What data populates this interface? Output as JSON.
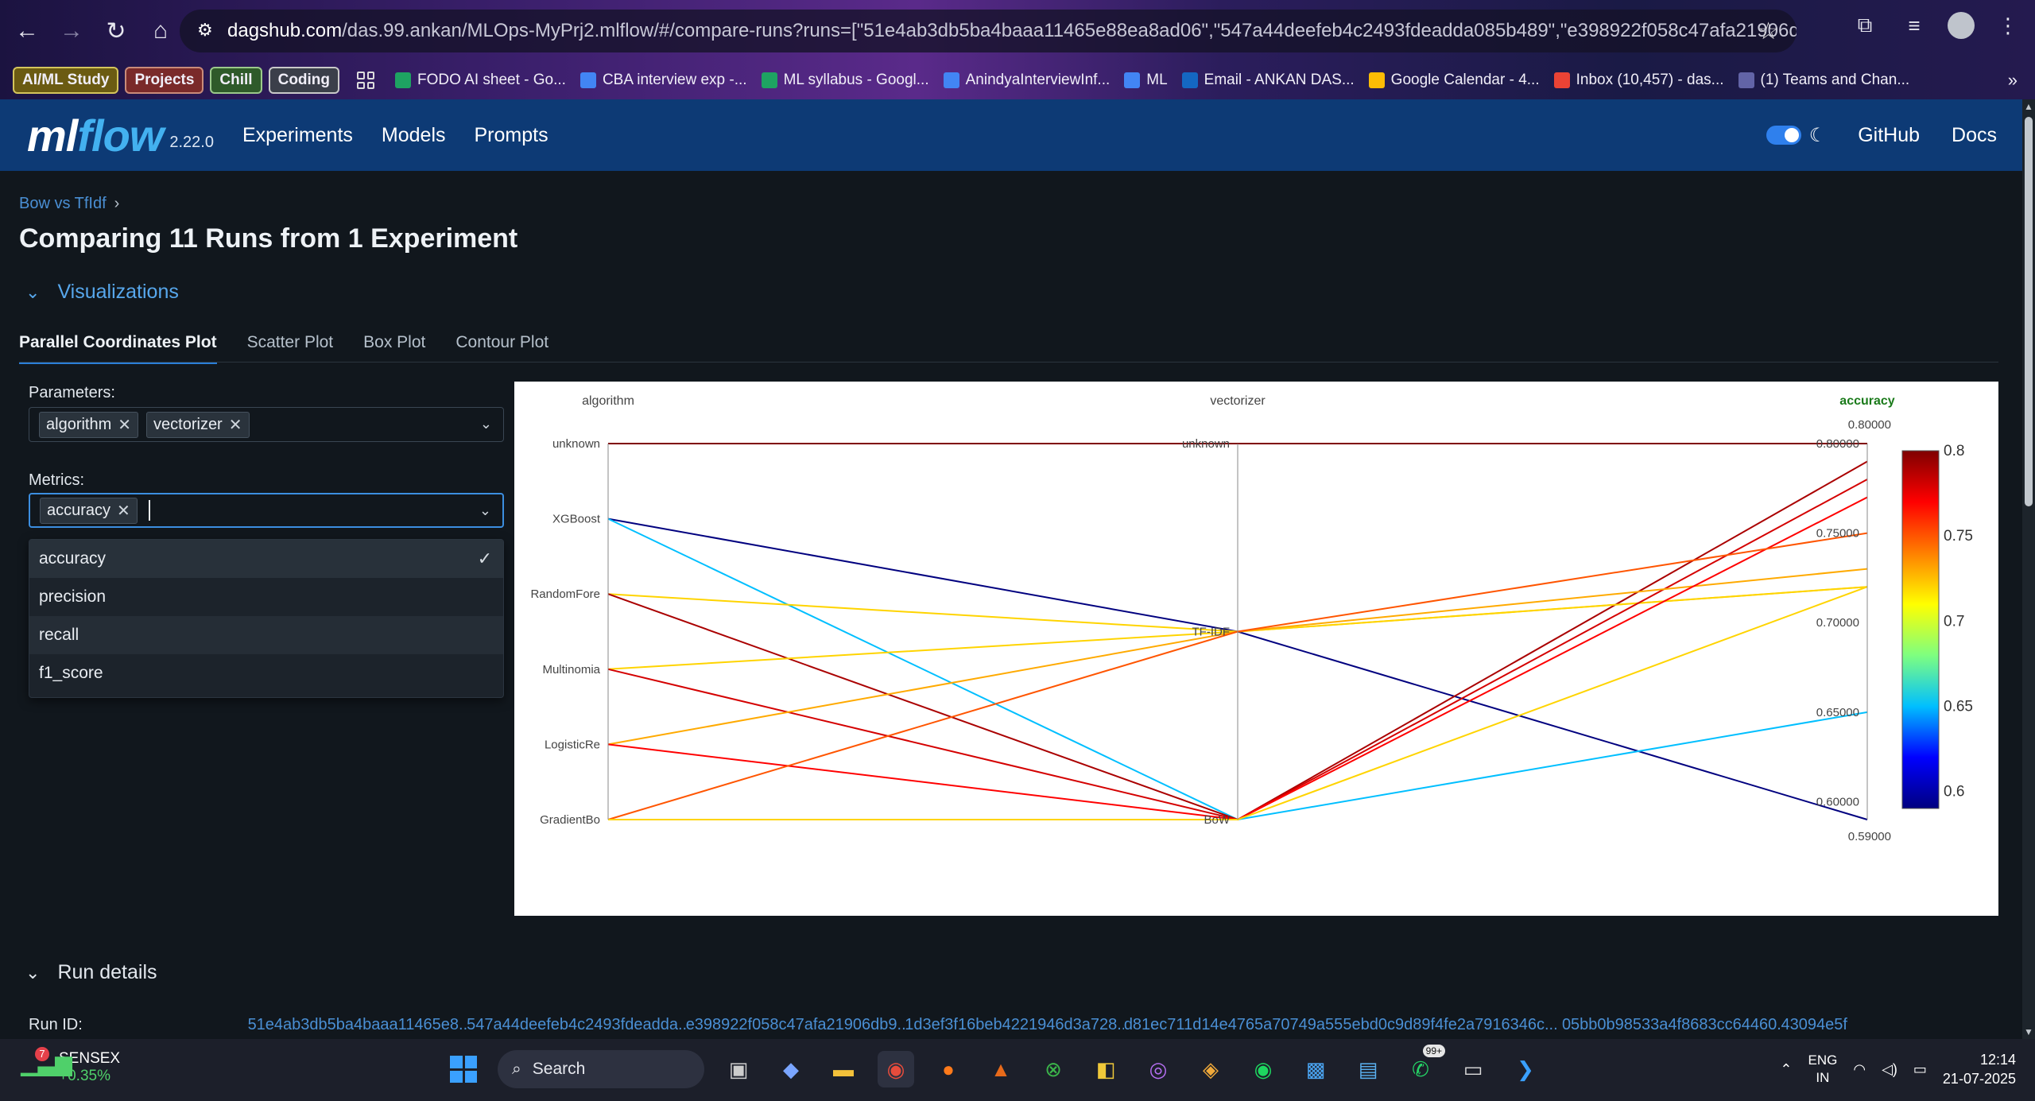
{
  "browser": {
    "url_host": "dagshub.com",
    "url_rest": "/das.99.ankan/MLOps-MyPrj2.mlflow/#/compare-runs?runs=[\"51e4ab3db5ba4baaa11465e88ea8ad06\",\"547a44deefeb4c2493fdeadda085b489\",\"e398922f058c47afa21906db92a2320e\",\"1d3ef3f16...",
    "bookmark_groups": [
      "AI/ML Study",
      "Projects",
      "Chill",
      "Coding"
    ],
    "bookmarks": [
      {
        "label": "FODO AI sheet - Go...",
        "color": "#1ea362"
      },
      {
        "label": "CBA interview exp -...",
        "color": "#4285f4"
      },
      {
        "label": "ML syllabus - Googl...",
        "color": "#1ea362"
      },
      {
        "label": "AnindyaInterviewInf...",
        "color": "#4285f4"
      },
      {
        "label": "ML",
        "color": "#4285f4"
      },
      {
        "label": "Email - ANKAN DAS...",
        "color": "#1467c2"
      },
      {
        "label": "Google Calendar - 4...",
        "color": "#fbbc05"
      },
      {
        "label": "Inbox (10,457) - das...",
        "color": "#ea4335"
      },
      {
        "label": "(1) Teams and Chan...",
        "color": "#6264a7"
      }
    ]
  },
  "mlflow": {
    "logo_ml": "ml",
    "logo_flow": "flow",
    "version": "2.22.0",
    "nav": [
      "Experiments",
      "Models",
      "Prompts"
    ],
    "github": "GitHub",
    "docs": "Docs"
  },
  "page": {
    "breadcrumb": "Bow vs TfIdf",
    "breadcrumb_sep": "›",
    "title": "Comparing 11 Runs from 1 Experiment",
    "section": "Visualizations",
    "tabs": [
      "Parallel Coordinates Plot",
      "Scatter Plot",
      "Box Plot",
      "Contour Plot"
    ],
    "params_label": "Parameters:",
    "params_chips": [
      "algorithm",
      "vectorizer"
    ],
    "metrics_label": "Metrics:",
    "metrics_chips": [
      "accuracy"
    ],
    "dropdown_options": [
      "accuracy",
      "precision",
      "recall",
      "f1_score"
    ],
    "run_details": "Run details",
    "run_id_label": "Run ID:",
    "run_ids": [
      "51e4ab3db5ba4baaa11465e8...",
      "547a44deefeb4c2493fdeadda...",
      "e398922f058c47afa21906db9...",
      "1d3ef3f16beb4221946d3a728...",
      "d81ec711d14e4765a70749a55...",
      "5ebd0c9d89f4fe2a7916346c...",
      "05bb0b98533a4f8683cc64460...",
      "43094e5f"
    ]
  },
  "chart_data": {
    "type": "parallel-coordinates",
    "axes": [
      {
        "name": "algorithm",
        "categories": [
          "unknown",
          "XGBoost",
          "RandomFore",
          "Multinomia",
          "LogisticRe",
          "GradientBo"
        ]
      },
      {
        "name": "vectorizer",
        "categories": [
          "unknown",
          "TF-IDF",
          "BoW"
        ]
      },
      {
        "name": "accuracy",
        "ticks": [
          0.8,
          0.75,
          0.7,
          0.65,
          0.6
        ],
        "range_label_top": "0.80000",
        "range_label_bottom": "0.59000",
        "ylim": [
          0.59,
          0.8
        ]
      }
    ],
    "colorbar": {
      "min": 0.59,
      "max": 0.8,
      "ticks": [
        0.8,
        0.75,
        0.7,
        0.65,
        0.6
      ],
      "colorscale": [
        "#00007f",
        "#0000ff",
        "#00bfff",
        "#7fff7f",
        "#ffff00",
        "#ff7f00",
        "#ff0000",
        "#7f0000"
      ]
    },
    "runs": [
      {
        "algorithm": "unknown",
        "vectorizer": "unknown",
        "accuracy": 0.8
      },
      {
        "algorithm": "XGBoost",
        "vectorizer": "TF-IDF",
        "accuracy": 0.59
      },
      {
        "algorithm": "XGBoost",
        "vectorizer": "BoW",
        "accuracy": 0.65
      },
      {
        "algorithm": "RandomFore",
        "vectorizer": "TF-IDF",
        "accuracy": 0.72
      },
      {
        "algorithm": "RandomFore",
        "vectorizer": "BoW",
        "accuracy": 0.79
      },
      {
        "algorithm": "Multinomia",
        "vectorizer": "TF-IDF",
        "accuracy": 0.72
      },
      {
        "algorithm": "Multinomia",
        "vectorizer": "BoW",
        "accuracy": 0.78
      },
      {
        "algorithm": "LogisticRe",
        "vectorizer": "TF-IDF",
        "accuracy": 0.73
      },
      {
        "algorithm": "LogisticRe",
        "vectorizer": "BoW",
        "accuracy": 0.77
      },
      {
        "algorithm": "GradientBo",
        "vectorizer": "TF-IDF",
        "accuracy": 0.75
      },
      {
        "algorithm": "GradientBo",
        "vectorizer": "BoW",
        "accuracy": 0.72
      }
    ]
  },
  "taskbar": {
    "ticker": "SENSEX",
    "ticker_change": "+0.35%",
    "ticker_badge": "7",
    "search": "Search",
    "lang1": "ENG",
    "lang2": "IN",
    "time": "12:14",
    "date": "21-07-2025",
    "whatsapp_badge": "99+"
  }
}
